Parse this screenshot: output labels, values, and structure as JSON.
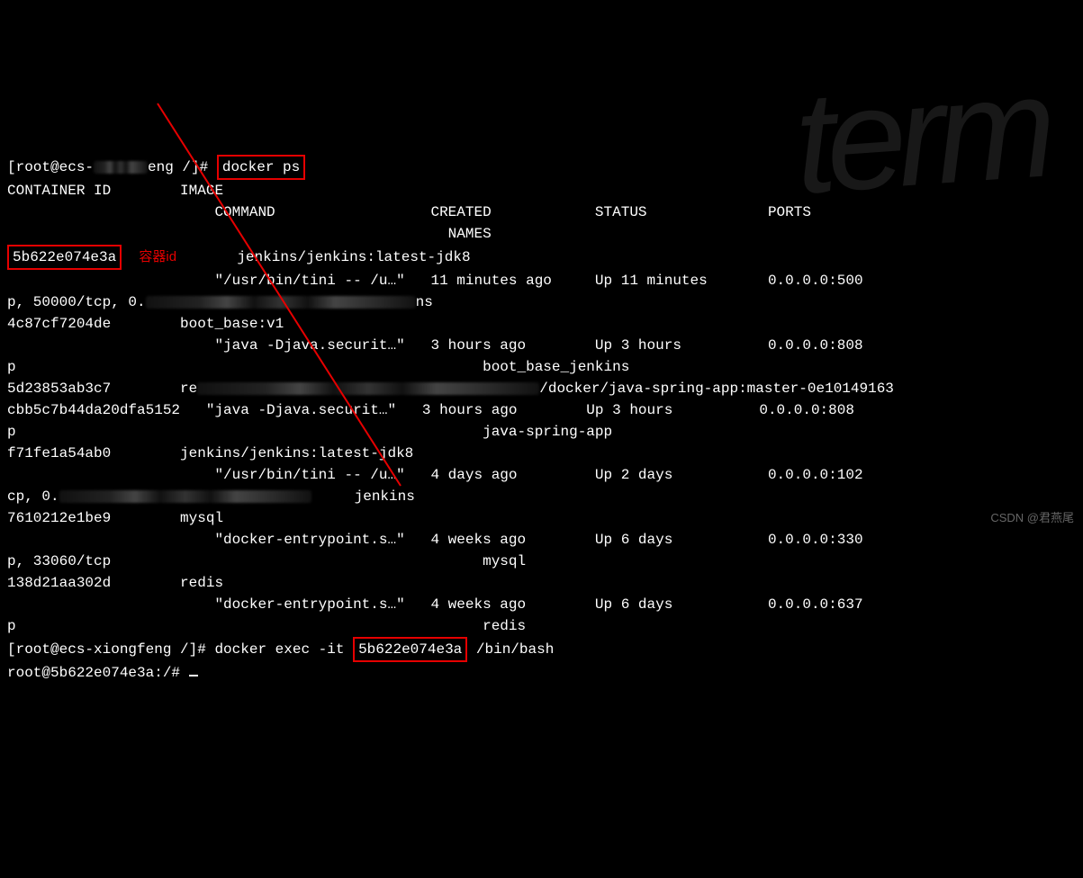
{
  "prompt1_a": "[root@ecs-",
  "prompt1_b": "eng /]#",
  "cmd1": "docker ps",
  "hdr": "CONTAINER ID        IMAGE",
  "hdr2": "                        COMMAND                  CREATED            STATUS              PORTS",
  "hdr3": "                                                   NAMES",
  "annot_label": "容器id",
  "r1_id": "5b622e074e3a",
  "r1_img": "       jenkins/jenkins:latest-jdk8",
  "r1_b": "                        \"/usr/bin/tini -- /u…\"   11 minutes ago     Up 11 minutes       0.0.0.0:500",
  "r1_c_pre": "p, 50000/tcp, 0.",
  "r1_c_post": "ns",
  "r2_a": "4c87cf7204de        boot_base:v1",
  "r2_b": "                        \"java -Djava.securit…\"   3 hours ago        Up 3 hours          0.0.0.0:808",
  "r2_c": "p                                                      boot_base_jenkins",
  "r3_a_pre": "5d23853ab3c7        re",
  "r3_a_post": "/docker/java-spring-app:master-0e10149163",
  "r3_b": "cbb5c7b44da20dfa5152   \"java -Djava.securit…\"   3 hours ago        Up 3 hours          0.0.0.0:808",
  "r3_c": "p                                                      java-spring-app",
  "r4_a": "f71fe1a54ab0        jenkins/jenkins:latest-jdk8",
  "r4_b": "                        \"/usr/bin/tini -- /u…\"   4 days ago         Up 2 days           0.0.0.0:102",
  "r4_c_pre": "cp, 0.",
  "r4_c_post": "     jenkins",
  "r5_a": "7610212e1be9        mysql",
  "r5_b": "                        \"docker-entrypoint.s…\"   4 weeks ago        Up 6 days           0.0.0.0:330",
  "r5_c": "p, 33060/tcp                                           mysql",
  "r6_a": "138d21aa302d        redis",
  "r6_b": "                        \"docker-entrypoint.s…\"   4 weeks ago        Up 6 days           0.0.0.0:637",
  "r6_c": "p                                                      redis",
  "prompt2": "[root@ecs-xiongfeng /]# docker exec -it ",
  "cmd2_box": "5b622e074e3a",
  "cmd2_tail": " /bin/bash",
  "prompt3": "root@5b622e074e3a:/# ",
  "watermark": "CSDN @君燕尾"
}
